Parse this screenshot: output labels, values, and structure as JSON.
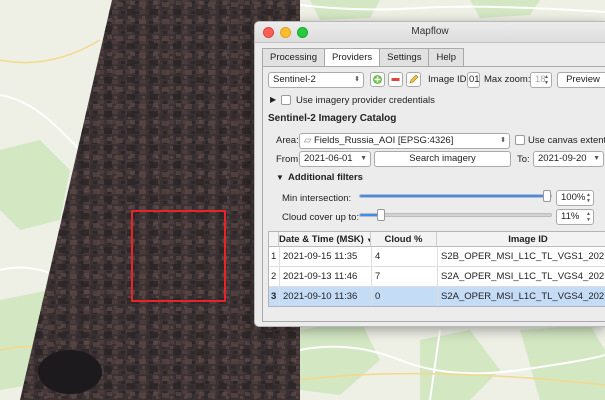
{
  "window": {
    "title": "Mapflow",
    "tabs": [
      {
        "label": "Processing",
        "active": false
      },
      {
        "label": "Providers",
        "active": true
      },
      {
        "label": "Settings",
        "active": false
      },
      {
        "label": "Help",
        "active": false
      }
    ]
  },
  "providers": {
    "provider_select": "Sentinel-2",
    "image_id_label": "Image ID:",
    "image_id_value": "01",
    "max_zoom_label": "Max zoom:",
    "max_zoom_value": "18",
    "preview_button": "Preview",
    "credentials_label": "Use imagery provider credentials"
  },
  "catalog": {
    "title": "Sentinel-2 Imagery Catalog",
    "area_label": "Area:",
    "area_value": "Fields_Russia_AOI [EPSG:4326]",
    "use_canvas_label": "Use canvas extent",
    "from_label": "From:",
    "from_value": "2021-06-01",
    "search_button": "Search imagery",
    "to_label": "To:",
    "to_value": "2021-09-20"
  },
  "filters": {
    "title": "Additional filters",
    "min_intersection_label": "Min intersection:",
    "min_intersection_value": "100%",
    "min_intersection_level": 100,
    "cloud_cover_label": "Cloud cover up to:",
    "cloud_cover_value": "11%",
    "cloud_cover_level": 11
  },
  "table": {
    "headers": [
      "Date & Time (MSK)",
      "Cloud %",
      "Image ID"
    ],
    "rows": [
      {
        "index": "1",
        "datetime": "2021-09-15 11:35",
        "cloud": "4",
        "image_id": "S2B_OPER_MSI_L1C_TL_VGS1_202..."
      },
      {
        "index": "2",
        "datetime": "2021-09-13 11:46",
        "cloud": "7",
        "image_id": "S2A_OPER_MSI_L1C_TL_VGS4_202..."
      },
      {
        "index": "3",
        "datetime": "2021-09-10 11:36",
        "cloud": "0",
        "image_id": "S2A_OPER_MSI_L1C_TL_VGS4_202..."
      }
    ],
    "selected_row": 3
  },
  "colors": {
    "accent": "#3b8df5",
    "selection": "#c5dcf7",
    "aoi": "#e8232a"
  }
}
